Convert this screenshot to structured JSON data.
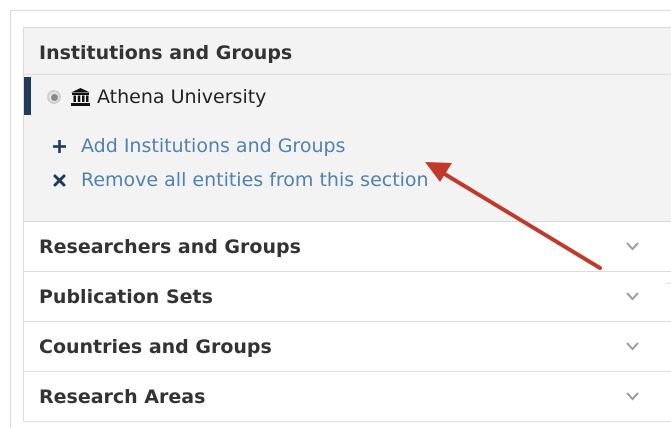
{
  "institutions_section": {
    "title": "Institutions and Groups",
    "entity": {
      "label": "Athena University",
      "icon": "institution-icon",
      "selected": true
    },
    "actions": [
      {
        "label": "Add Institutions and Groups",
        "icon": "plus-icon"
      },
      {
        "label": "Remove all entities from this section",
        "icon": "x-icon"
      }
    ]
  },
  "collapsed_sections": [
    {
      "label": "Researchers and Groups",
      "icon": "chevron-down-icon"
    },
    {
      "label": "Publication Sets",
      "icon": "chevron-down-icon"
    },
    {
      "label": "Countries and Groups",
      "icon": "chevron-down-icon"
    },
    {
      "label": "Research Areas",
      "icon": "chevron-down-icon"
    }
  ],
  "colors": {
    "entity_bar": "#1f3b5c",
    "link": "#4f81b3",
    "annotation_arrow": "#c0392b"
  }
}
